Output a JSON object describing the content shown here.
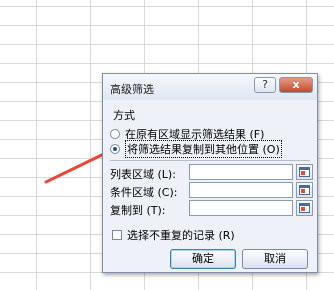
{
  "dialog": {
    "title": "高级筛选",
    "help_label": "?",
    "close_label": "x"
  },
  "method": {
    "group_label": "方式",
    "options": [
      {
        "label": "在原有区域显示筛选结果 (F)",
        "checked": false
      },
      {
        "label": "将筛选结果复制到其他位置 (O)",
        "checked": true
      }
    ]
  },
  "fields": {
    "list_range": {
      "label": "列表区域 (L):",
      "value": ""
    },
    "criteria_range": {
      "label": "条件区域 (C):",
      "value": ""
    },
    "copy_to": {
      "label": "复制到 (T):",
      "value": ""
    }
  },
  "unique_records": {
    "label": "选择不重复的记录 (R)",
    "checked": false
  },
  "buttons": {
    "ok_label": "确定",
    "cancel_label": "取消"
  },
  "colors": {
    "dialog_bg": "#eef2f8",
    "arrow": "#e8473a",
    "close_button": "#c44a2e"
  },
  "icons": {
    "collapse_dialog": "range-select-icon",
    "annotation": "red-arrow-icon"
  }
}
